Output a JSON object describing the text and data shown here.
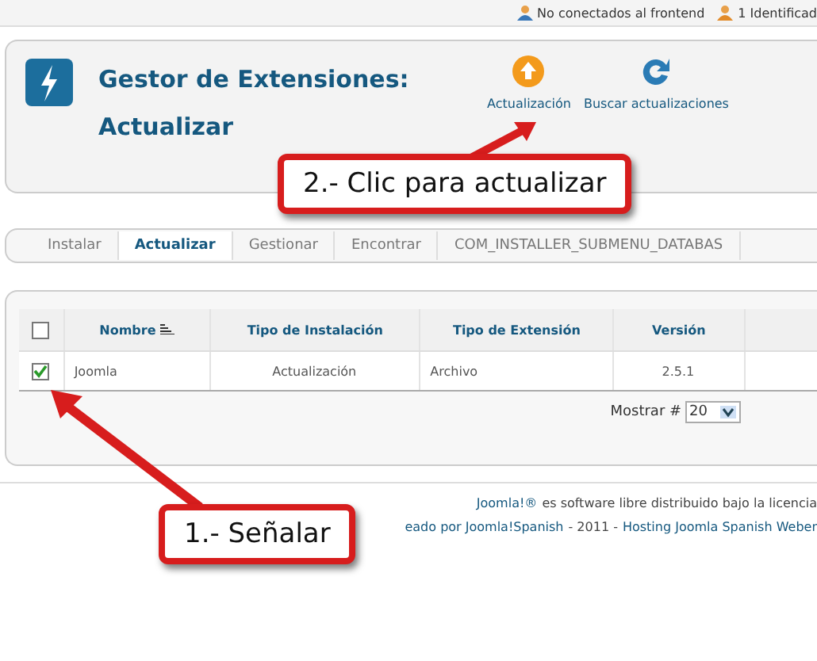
{
  "status_bar": [
    {
      "kind": "frontend",
      "label": "No conectados al frontend"
    },
    {
      "kind": "admin",
      "label": "1 Identificad"
    }
  ],
  "header": {
    "title": "Gestor de Extensiones:",
    "subtitle": "Actualizar"
  },
  "toolbar": [
    {
      "kind": "update",
      "label": "Actualización"
    },
    {
      "kind": "refresh",
      "label": "Buscar actualizaciones"
    }
  ],
  "submenu": [
    {
      "label": "Instalar",
      "selected": false
    },
    {
      "label": "Actualizar",
      "selected": true
    },
    {
      "label": "Gestionar",
      "selected": false
    },
    {
      "label": "Encontrar",
      "selected": false
    },
    {
      "label": "COM_INSTALLER_SUBMENU_DATABAS",
      "selected": false
    }
  ],
  "table": {
    "select_all_checked": false,
    "columns": [
      "Nombre",
      "Tipo de Instalación",
      "Tipo de Extensión",
      "Versión"
    ],
    "rows": [
      {
        "checked": true,
        "cells": [
          "Joomla",
          "Actualización",
          "Archivo",
          "2.5.1"
        ]
      }
    ]
  },
  "pagination": {
    "label": "Mostrar #",
    "value": "20"
  },
  "footer": {
    "line_1_link": "Joomla!®",
    "line_1": "es software libre distribuido bajo la licencia",
    "line_2_link_1": "eado por Joomla!Spanish",
    "line_2_sep_1": "- 2011 -",
    "line_2_link_2": "Hosting Joomla Spanish Weber"
  },
  "callouts": [
    {
      "text": "2.- Clic para actualizar"
    },
    {
      "text": "1.- Señalar"
    }
  ]
}
